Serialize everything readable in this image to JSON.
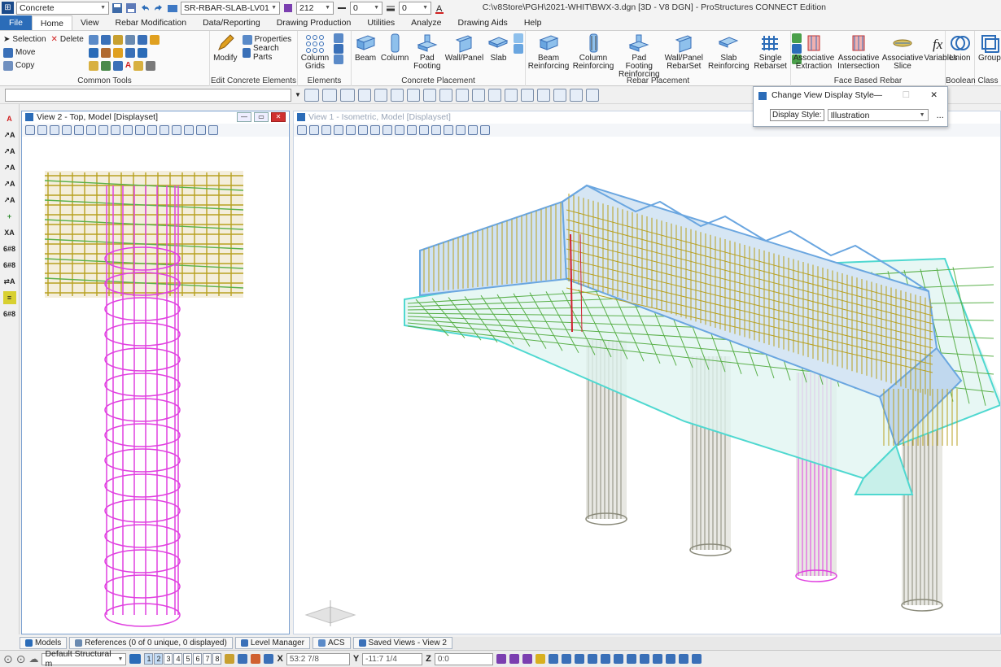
{
  "app": {
    "title": "C:\\v8Store\\PGH\\2021-WHIT\\BWX-3.dgn [3D - V8 DGN] - ProStructures CONNECT Edition"
  },
  "quick_access": {
    "workflow_value": "Concrete",
    "level_value": "SR-RBAR-SLAB-LV01",
    "color_value": "212",
    "style_value": "0",
    "weight_value": "0",
    "icons": [
      "save-icon",
      "undo-icon",
      "redo-icon",
      "color-icon",
      "text-color-icon"
    ]
  },
  "tabs": [
    "File",
    "Home",
    "View",
    "Rebar Modification",
    "Data/Reporting",
    "Drawing Production",
    "Utilities",
    "Analyze",
    "Drawing Aids",
    "Help"
  ],
  "active_tab": "Home",
  "ribbon": {
    "common_tools": {
      "label": "Common Tools",
      "selection": "Selection",
      "delete": "Delete",
      "move": "Move",
      "copy": "Copy"
    },
    "edit_concrete": {
      "label": "Edit Concrete Elements",
      "modify": "Modify",
      "properties": "Properties",
      "search_parts": "Search Parts"
    },
    "elements": {
      "label": "Elements",
      "column_grids_1": "Column",
      "column_grids_2": "Grids"
    },
    "concrete_placement": {
      "label": "Concrete Placement",
      "beam": "Beam",
      "column": "Column",
      "pad_footing_1": "Pad",
      "pad_footing_2": "Footing",
      "wall_panel": "Wall/Panel",
      "slab": "Slab"
    },
    "rebar_placement": {
      "label": "Rebar Placement",
      "beam_reinf_1": "Beam",
      "beam_reinf_2": "Reinforcing",
      "column_reinf_1": "Column",
      "column_reinf_2": "Reinforcing",
      "pad_reinf_1": "Pad Footing",
      "pad_reinf_2": "Reinforcing",
      "wall_rebarset_1": "Wall/Panel",
      "wall_rebarset_2": "RebarSet",
      "slab_reinf_1": "Slab",
      "slab_reinf_2": "Reinforcing",
      "single_rebarset_1": "Single",
      "single_rebarset_2": "Rebarset"
    },
    "face_based": {
      "label": "Face Based Rebar",
      "extraction_1": "Associative",
      "extraction_2": "Extraction",
      "intersection_1": "Associative",
      "intersection_2": "Intersection",
      "slice_1": "Associative",
      "slice_2": "Slice",
      "variables": "Variables"
    },
    "boolean": {
      "label": "Boolean",
      "union": "Union"
    },
    "class_group": {
      "label": "Class",
      "group": "Group"
    }
  },
  "dialog": {
    "title": "Change View Display Style",
    "display_style_label": "Display Style:",
    "display_style_value": "Illustration",
    "more": "..."
  },
  "view2": {
    "title": "View 2 - Top, Model [Displayset]"
  },
  "view1": {
    "title": "View 1 - Isometric, Model [Displayset]"
  },
  "bottom_tabs": {
    "models": "Models",
    "references": "References (0 of 0 unique, 0 displayed)",
    "level_manager": "Level Manager",
    "acs": "ACS",
    "saved_views": "Saved Views - View 2"
  },
  "status": {
    "model": "Default Structural m",
    "view_numbers": [
      "1",
      "2",
      "3",
      "4",
      "5",
      "6",
      "7",
      "8"
    ],
    "active_views": [
      "1",
      "2"
    ],
    "x_label": "X",
    "x_value": "53:2 7/8",
    "y_label": "Y",
    "y_value": "-11:7 1/4",
    "z_label": "Z",
    "z_value": "0:0"
  },
  "colors": {
    "file_tab": "#2b6cb8",
    "rebar_column": "#e040e0",
    "rebar_yellow": "#b8a020",
    "slab_blue": "#6aa6e0",
    "footing_cyan": "#4fd8d0",
    "rebar_green": "#5ab04a",
    "pile_grey": "#8a8a7a"
  }
}
